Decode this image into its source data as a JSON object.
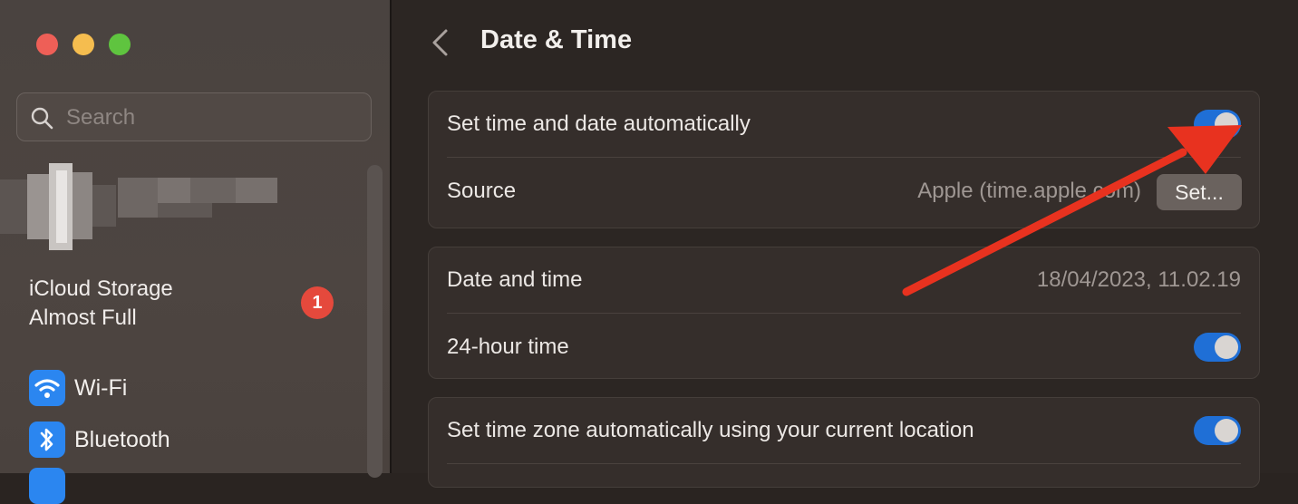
{
  "window": {
    "title": "Date & Time"
  },
  "sidebar": {
    "search_placeholder": "Search",
    "notice": {
      "line1": "iCloud Storage",
      "line2": "Almost Full",
      "badge": "1"
    },
    "items": [
      {
        "label": "Wi-Fi",
        "icon": "wifi-icon"
      },
      {
        "label": "Bluetooth",
        "icon": "bluetooth-icon"
      }
    ]
  },
  "settings": {
    "group1": {
      "auto_label": "Set time and date automatically",
      "auto_on": true,
      "source_label": "Source",
      "source_value": "Apple (time.apple.com)",
      "set_button": "Set..."
    },
    "group2": {
      "datetime_label": "Date and time",
      "datetime_value": "18/04/2023, 11.02.19",
      "hour24_label": "24-hour time",
      "hour24_on": true
    },
    "group3": {
      "timezone_label": "Set time zone automatically using your current location",
      "timezone_on": true
    }
  },
  "colors": {
    "accent": "#1f6fd6",
    "badge": "#e5493c",
    "annotation_arrow": "#e8321f"
  }
}
